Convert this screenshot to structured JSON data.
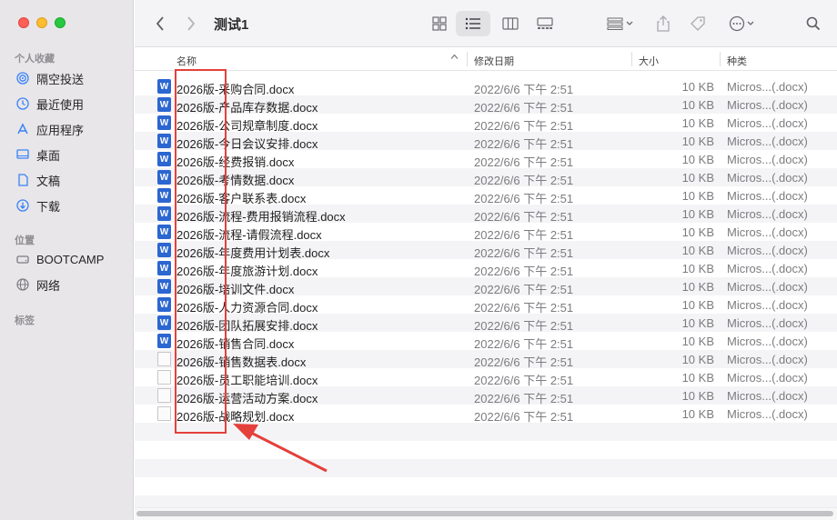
{
  "window": {
    "title": "测试1"
  },
  "sidebar": {
    "favorites_label": "个人收藏",
    "favorites": [
      {
        "label": "隔空投送",
        "icon": "airdrop-icon"
      },
      {
        "label": "最近使用",
        "icon": "clock-icon"
      },
      {
        "label": "应用程序",
        "icon": "applications-icon"
      },
      {
        "label": "桌面",
        "icon": "desktop-icon"
      },
      {
        "label": "文稿",
        "icon": "document-icon"
      },
      {
        "label": "下载",
        "icon": "download-icon"
      }
    ],
    "locations_label": "位置",
    "locations": [
      {
        "label": "BOOTCAMP",
        "icon": "disk-icon"
      },
      {
        "label": "网络",
        "icon": "network-icon"
      }
    ],
    "tags_label": "标签"
  },
  "columns": {
    "name": "名称",
    "date": "修改日期",
    "size": "大小",
    "kind": "种类"
  },
  "files": [
    {
      "name": "2026版-采购合同.docx",
      "date": "2022/6/6 下午 2:51",
      "size": "10 KB",
      "kind": "Micros...(.docx)",
      "icon": "word"
    },
    {
      "name": "2026版-产品库存数据.docx",
      "date": "2022/6/6 下午 2:51",
      "size": "10 KB",
      "kind": "Micros...(.docx)",
      "icon": "word"
    },
    {
      "name": "2026版-公司规章制度.docx",
      "date": "2022/6/6 下午 2:51",
      "size": "10 KB",
      "kind": "Micros...(.docx)",
      "icon": "word"
    },
    {
      "name": "2026版-今日会议安排.docx",
      "date": "2022/6/6 下午 2:51",
      "size": "10 KB",
      "kind": "Micros...(.docx)",
      "icon": "word"
    },
    {
      "name": "2026版-经费报销.docx",
      "date": "2022/6/6 下午 2:51",
      "size": "10 KB",
      "kind": "Micros...(.docx)",
      "icon": "word"
    },
    {
      "name": "2026版-考情数据.docx",
      "date": "2022/6/6 下午 2:51",
      "size": "10 KB",
      "kind": "Micros...(.docx)",
      "icon": "word"
    },
    {
      "name": "2026版-客户联系表.docx",
      "date": "2022/6/6 下午 2:51",
      "size": "10 KB",
      "kind": "Micros...(.docx)",
      "icon": "word"
    },
    {
      "name": "2026版-流程-费用报销流程.docx",
      "date": "2022/6/6 下午 2:51",
      "size": "10 KB",
      "kind": "Micros...(.docx)",
      "icon": "word"
    },
    {
      "name": "2026版-流程-请假流程.docx",
      "date": "2022/6/6 下午 2:51",
      "size": "10 KB",
      "kind": "Micros...(.docx)",
      "icon": "word"
    },
    {
      "name": "2026版-年度费用计划表.docx",
      "date": "2022/6/6 下午 2:51",
      "size": "10 KB",
      "kind": "Micros...(.docx)",
      "icon": "word"
    },
    {
      "name": "2026版-年度旅游计划.docx",
      "date": "2022/6/6 下午 2:51",
      "size": "10 KB",
      "kind": "Micros...(.docx)",
      "icon": "word"
    },
    {
      "name": "2026版-培训文件.docx",
      "date": "2022/6/6 下午 2:51",
      "size": "10 KB",
      "kind": "Micros...(.docx)",
      "icon": "word"
    },
    {
      "name": "2026版-人力资源合同.docx",
      "date": "2022/6/6 下午 2:51",
      "size": "10 KB",
      "kind": "Micros...(.docx)",
      "icon": "word"
    },
    {
      "name": "2026版-团队拓展安排.docx",
      "date": "2022/6/6 下午 2:51",
      "size": "10 KB",
      "kind": "Micros...(.docx)",
      "icon": "word"
    },
    {
      "name": "2026版-销售合同.docx",
      "date": "2022/6/6 下午 2:51",
      "size": "10 KB",
      "kind": "Micros...(.docx)",
      "icon": "word"
    },
    {
      "name": "2026版-销售数据表.docx",
      "date": "2022/6/6 下午 2:51",
      "size": "10 KB",
      "kind": "Micros...(.docx)",
      "icon": "generic"
    },
    {
      "name": "2026版-员工职能培训.docx",
      "date": "2022/6/6 下午 2:51",
      "size": "10 KB",
      "kind": "Micros...(.docx)",
      "icon": "generic"
    },
    {
      "name": "2026版-运营活动方案.docx",
      "date": "2022/6/6 下午 2:51",
      "size": "10 KB",
      "kind": "Micros...(.docx)",
      "icon": "generic"
    },
    {
      "name": "2026版-战略规划.docx",
      "date": "2022/6/6 下午 2:51",
      "size": "10 KB",
      "kind": "Micros...(.docx)",
      "icon": "generic"
    }
  ],
  "colors": {
    "annotation": "#e4403c",
    "word_icon": "#2b66d1",
    "accent": "#3a82f7"
  }
}
